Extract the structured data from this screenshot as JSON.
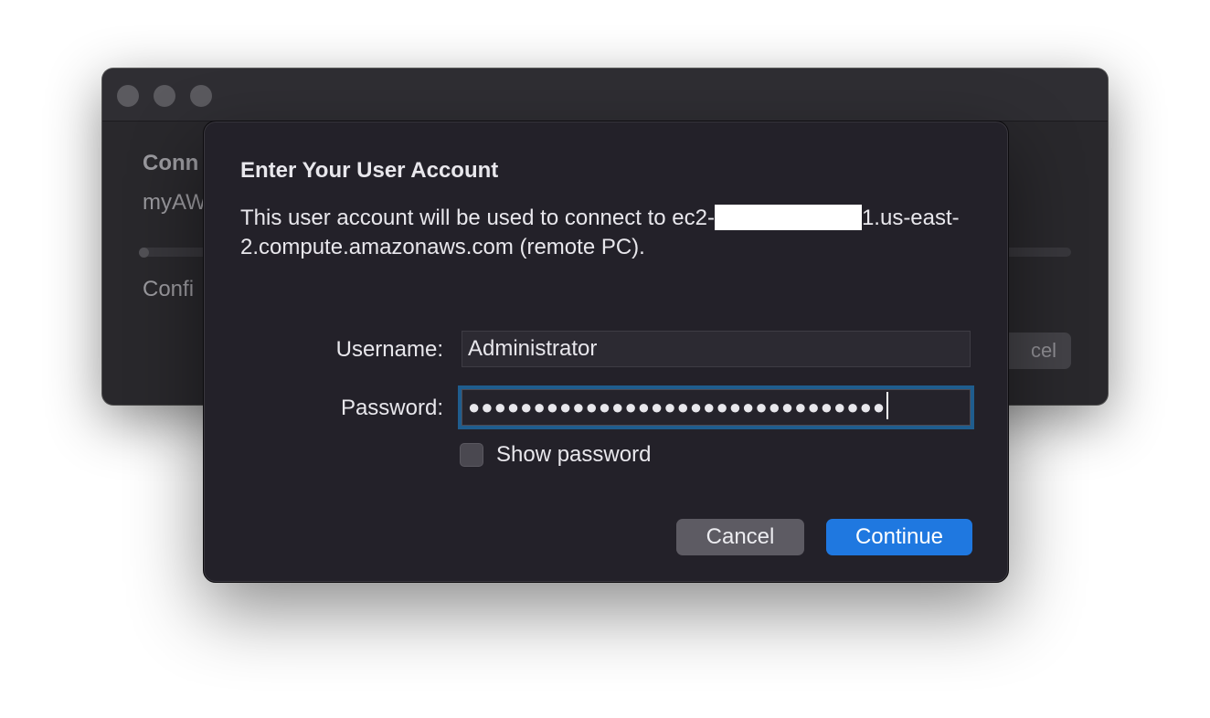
{
  "background_window": {
    "heading": "Conn",
    "connection_name": "myAW",
    "status": "Confi",
    "cancel_label": "cel"
  },
  "dialog": {
    "title": "Enter Your User Account",
    "message_prefix": "This user account will be used to connect to ec2-",
    "message_suffix": "1.us-east-2.compute.amazonaws.com (remote PC).",
    "username_label": "Username:",
    "username_value": "Administrator",
    "password_label": "Password:",
    "password_masked": "●●●●●●●●●●●●●●●●●●●●●●●●●●●●●●●●",
    "show_password_label": "Show password",
    "show_password_checked": false,
    "cancel_label": "Cancel",
    "continue_label": "Continue"
  },
  "colors": {
    "accent": "#1f78e0",
    "focus_ring": "#1f5d8e",
    "dialog_bg": "#232129"
  }
}
